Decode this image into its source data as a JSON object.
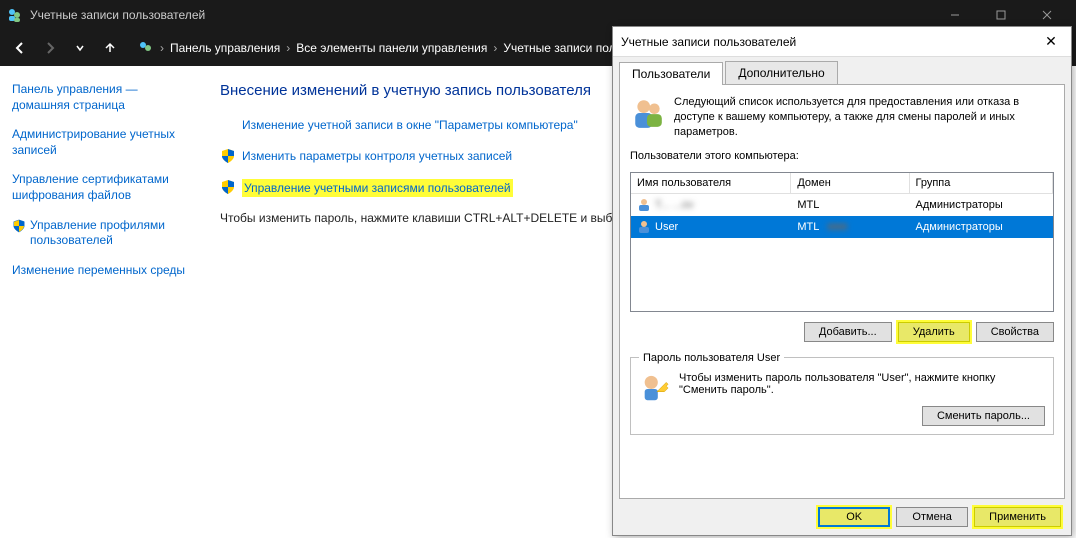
{
  "window": {
    "title": "Учетные записи пользователей"
  },
  "breadcrumb": {
    "items": [
      "Панель управления",
      "Все элементы панели управления",
      "Учетные записи польз..."
    ]
  },
  "sidebar": {
    "items": [
      {
        "label": "Панель управления — домашняя страница",
        "shield": false
      },
      {
        "label": "Администрирование учетных записей",
        "shield": false
      },
      {
        "label": "Управление сертификатами шифрования файлов",
        "shield": false
      },
      {
        "label": "Управление профилями пользователей",
        "shield": true
      },
      {
        "label": "Изменение переменных среды",
        "shield": false
      }
    ]
  },
  "main": {
    "heading": "Внесение изменений в учетную запись пользователя",
    "link1": "Изменение учетной записи в окне \"Параметры компьютера\"",
    "link2": "Изменить параметры контроля учетных записей",
    "link3": "Управление учетными записями пользователей",
    "body": "Чтобы изменить пароль, нажмите клавиши CTRL+ALT+DELETE и выбе"
  },
  "dialog": {
    "title": "Учетные записи пользователей",
    "tabs": {
      "users": "Пользователи",
      "advanced": "Дополнительно"
    },
    "intro": "Следующий список используется для предоставления или отказа в доступе к вашему компьютеру, а также для смены паролей и иных параметров.",
    "list_label": "Пользователи этого компьютера:",
    "columns": {
      "user": "Имя пользователя",
      "domain": "Домен",
      "group": "Группа"
    },
    "rows": [
      {
        "user": "T... ...ov",
        "domain": "MTL",
        "group": "Администраторы",
        "blurred": true,
        "selected": false
      },
      {
        "user": "User",
        "domain": "MTL",
        "group": "Администраторы",
        "blurred": false,
        "selected": true,
        "domain_suffix_blur": true
      }
    ],
    "buttons": {
      "add": "Добавить...",
      "remove": "Удалить",
      "props": "Свойства"
    },
    "pw_legend": "Пароль пользователя User",
    "pw_text": "Чтобы изменить пароль пользователя \"User\", нажмите кнопку \"Сменить пароль\".",
    "pw_button": "Сменить пароль...",
    "footer": {
      "ok": "OK",
      "cancel": "Отмена",
      "apply": "Применить"
    }
  }
}
